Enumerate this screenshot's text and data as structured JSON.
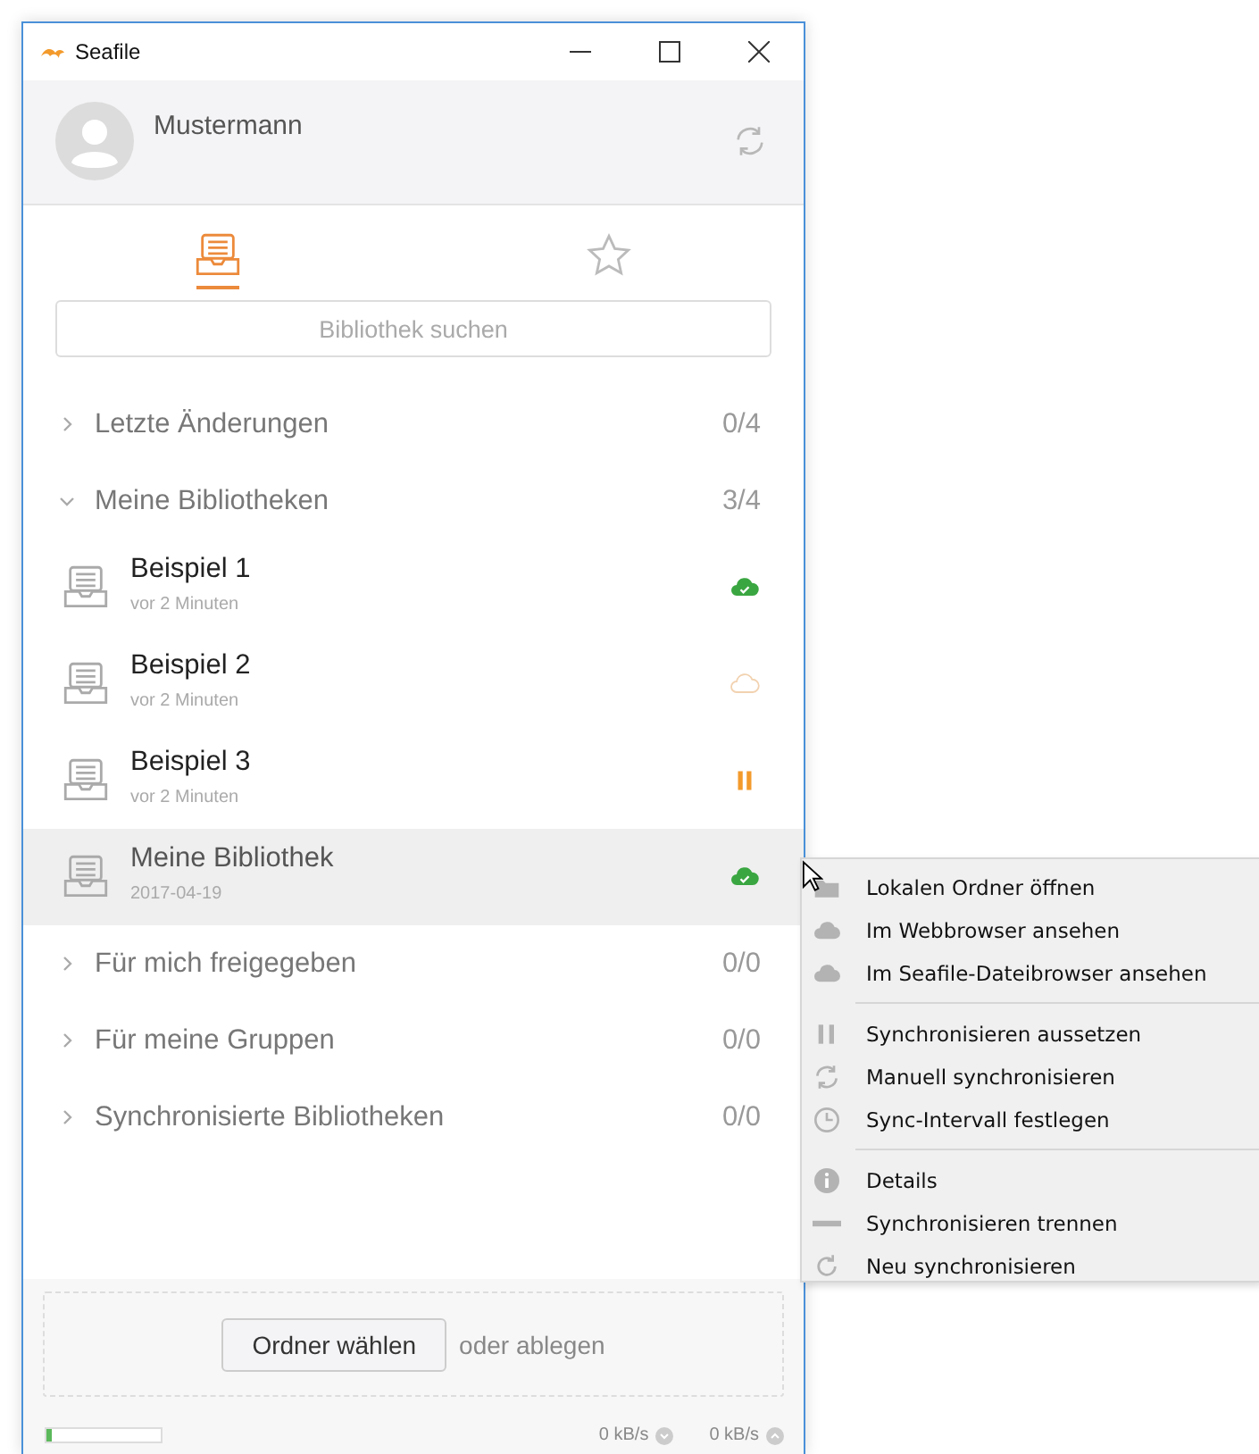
{
  "window": {
    "title": "Seafile"
  },
  "account": {
    "name": "Mustermann"
  },
  "tabs": [
    {
      "kind": "libraries",
      "selected": true
    },
    {
      "kind": "starred",
      "selected": false
    }
  ],
  "search": {
    "placeholder": "Bibliothek suchen"
  },
  "sections": [
    {
      "title": "Letzte Änderungen",
      "count": "0/4",
      "expanded": false
    },
    {
      "title": "Meine Bibliotheken",
      "count": "3/4",
      "expanded": true,
      "repos": [
        {
          "name": "Beispiel 1",
          "subtitle": "vor 2 Minuten",
          "kind": "synced",
          "selected": false
        },
        {
          "name": "Beispiel 2",
          "subtitle": "vor 2 Minuten",
          "kind": "cloud",
          "selected": false
        },
        {
          "name": "Beispiel 3",
          "subtitle": "vor 2 Minuten",
          "kind": "paused",
          "selected": false
        },
        {
          "name": "Meine Bibliothek",
          "subtitle": "2017-04-19",
          "kind": "synced",
          "selected": true
        }
      ]
    },
    {
      "title": "Für mich freigegeben",
      "count": "0/0",
      "expanded": false
    },
    {
      "title": "Für meine Gruppen",
      "count": "0/0",
      "expanded": false
    },
    {
      "title": "Synchronisierte Bibliotheken",
      "count": "0/0",
      "expanded": false
    }
  ],
  "drop_zone": {
    "button": "Ordner wählen",
    "hint": "oder ablegen"
  },
  "status_bar": {
    "progress": {
      "level": 0.05
    },
    "download": "0 kB/s",
    "upload": "0 kB/s"
  },
  "context_menu": {
    "groups": [
      {
        "items": [
          {
            "kind": "folder",
            "label": "Lokalen Ordner öffnen"
          },
          {
            "kind": "cloud",
            "label": "Im Webbrowser ansehen"
          },
          {
            "kind": "cloud",
            "label": "Im Seafile-Dateibrowser ansehen"
          }
        ]
      },
      {
        "items": [
          {
            "kind": "pause",
            "label": "Synchronisieren aussetzen"
          },
          {
            "kind": "sync",
            "label": "Manuell synchronisieren"
          },
          {
            "kind": "clock",
            "label": "Sync-Intervall festlegen"
          }
        ]
      },
      {
        "items": [
          {
            "kind": "info",
            "label": "Details"
          },
          {
            "kind": "minus",
            "label": "Synchronisieren trennen"
          },
          {
            "kind": "redo",
            "label": "Neu synchronisieren"
          }
        ]
      }
    ]
  }
}
